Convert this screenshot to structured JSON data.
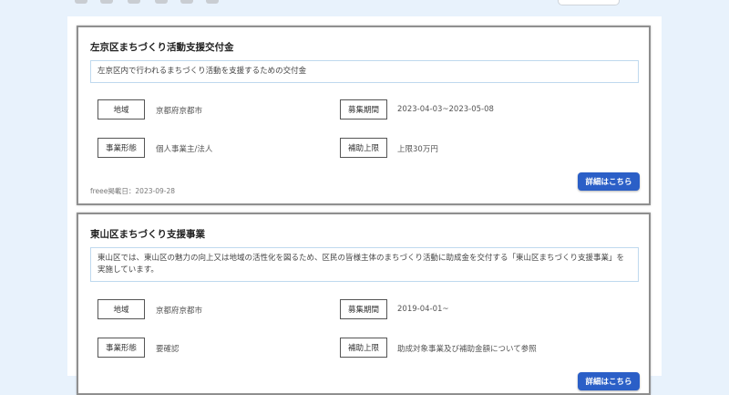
{
  "cards": [
    {
      "title": "左京区まちづくり活動支援交付金",
      "description": "左京区内で行われるまちづくり活動を支援するための交付金",
      "region_label": "地域",
      "region_value": "京都府京都市",
      "period_label": "募集期間",
      "period_value": "2023-04-03~2023-05-08",
      "business_type_label": "事業形態",
      "business_type_value": "個人事業主/法人",
      "subsidy_limit_label": "補助上限",
      "subsidy_limit_value": "上限30万円",
      "posted_date": "freee掲載日：2023-09-28",
      "detail_button": "詳細はこちら"
    },
    {
      "title": "東山区まちづくり支援事業",
      "description": "東山区では、東山区の魅力の向上又は地域の活性化を図るため、区民の皆様主体のまちづくり活動に助成金を交付する「東山区まちづくり支援事業」を実施しています。",
      "region_label": "地域",
      "region_value": "京都府京都市",
      "period_label": "募集期間",
      "period_value": "2019-04-01~",
      "business_type_label": "事業形態",
      "business_type_value": "要確認",
      "subsidy_limit_label": "補助上限",
      "subsidy_limit_value": "助成対象事業及び補助金額について参照",
      "detail_button": "詳細はこちら"
    }
  ]
}
